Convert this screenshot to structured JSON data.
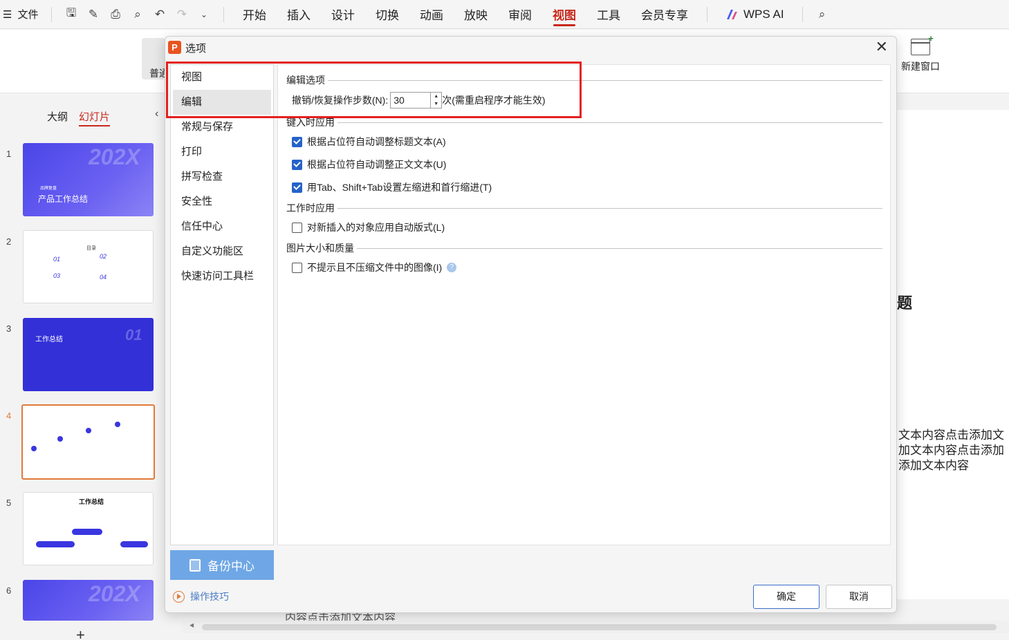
{
  "menubar": {
    "file_label": "文件",
    "tabs": [
      "开始",
      "插入",
      "设计",
      "切换",
      "动画",
      "放映",
      "审阅",
      "视图",
      "工具",
      "会员专享"
    ],
    "active_tab": "视图",
    "wps_ai": "WPS AI"
  },
  "ribbon": {
    "normal_label": "普通",
    "new_window_label": "新建窗口"
  },
  "left_panel": {
    "tab_outline": "大纲",
    "tab_slides": "幻灯片",
    "slide_numbers": [
      "1",
      "2",
      "3",
      "4",
      "5",
      "6"
    ],
    "selected_slide": "4",
    "slide1": {
      "big": "202X",
      "sub": "品牌复盘",
      "title": "产品工作总结"
    },
    "slide2": {
      "title": "目录",
      "items": [
        "01",
        "02",
        "03",
        "04"
      ]
    },
    "slide3": {
      "title": "工作总结",
      "big": "01"
    },
    "slide5": {
      "title": "工作总结"
    },
    "slide6": {
      "big": "202X"
    }
  },
  "canvas": {
    "title_fragment": "题",
    "body_lines": [
      "文本内容点击添加文",
      "加文本内容点击添加",
      "添加文本内容"
    ],
    "bottom_fragment": "内容点击添加文本内容"
  },
  "dialog": {
    "title": "选项",
    "app_icon": "P",
    "nav": [
      "视图",
      "编辑",
      "常规与保存",
      "打印",
      "拼写检查",
      "安全性",
      "信任中心",
      "自定义功能区",
      "快速访问工具栏"
    ],
    "nav_active": "编辑",
    "backup_label": "备份中心",
    "tips_label": "操作技巧",
    "ok_label": "确定",
    "cancel_label": "取消",
    "sections": {
      "edit_options": {
        "heading": "编辑选项",
        "undo_label": "撤销/恢复操作步数(N):",
        "undo_value": "30",
        "undo_suffix": "次(需重启程序才能生效)"
      },
      "typing": {
        "heading": "键入时应用",
        "items": [
          {
            "label": "根据占位符自动调整标题文本(A)",
            "checked": true
          },
          {
            "label": "根据占位符自动调整正文文本(U)",
            "checked": true
          },
          {
            "label": "用Tab、Shift+Tab设置左缩进和首行缩进(T)",
            "checked": true
          }
        ]
      },
      "working": {
        "heading": "工作时应用",
        "items": [
          {
            "label": "对新插入的对象应用自动版式(L)",
            "checked": false
          }
        ]
      },
      "image": {
        "heading": "图片大小和质量",
        "items": [
          {
            "label": "不提示且不压缩文件中的图像(I)",
            "checked": false
          }
        ]
      }
    }
  },
  "colors": {
    "accent_red": "#c8281c",
    "highlight_red": "#e51f1f",
    "checkbox_blue": "#2563c9",
    "slide_purple": "#4a45e8"
  }
}
